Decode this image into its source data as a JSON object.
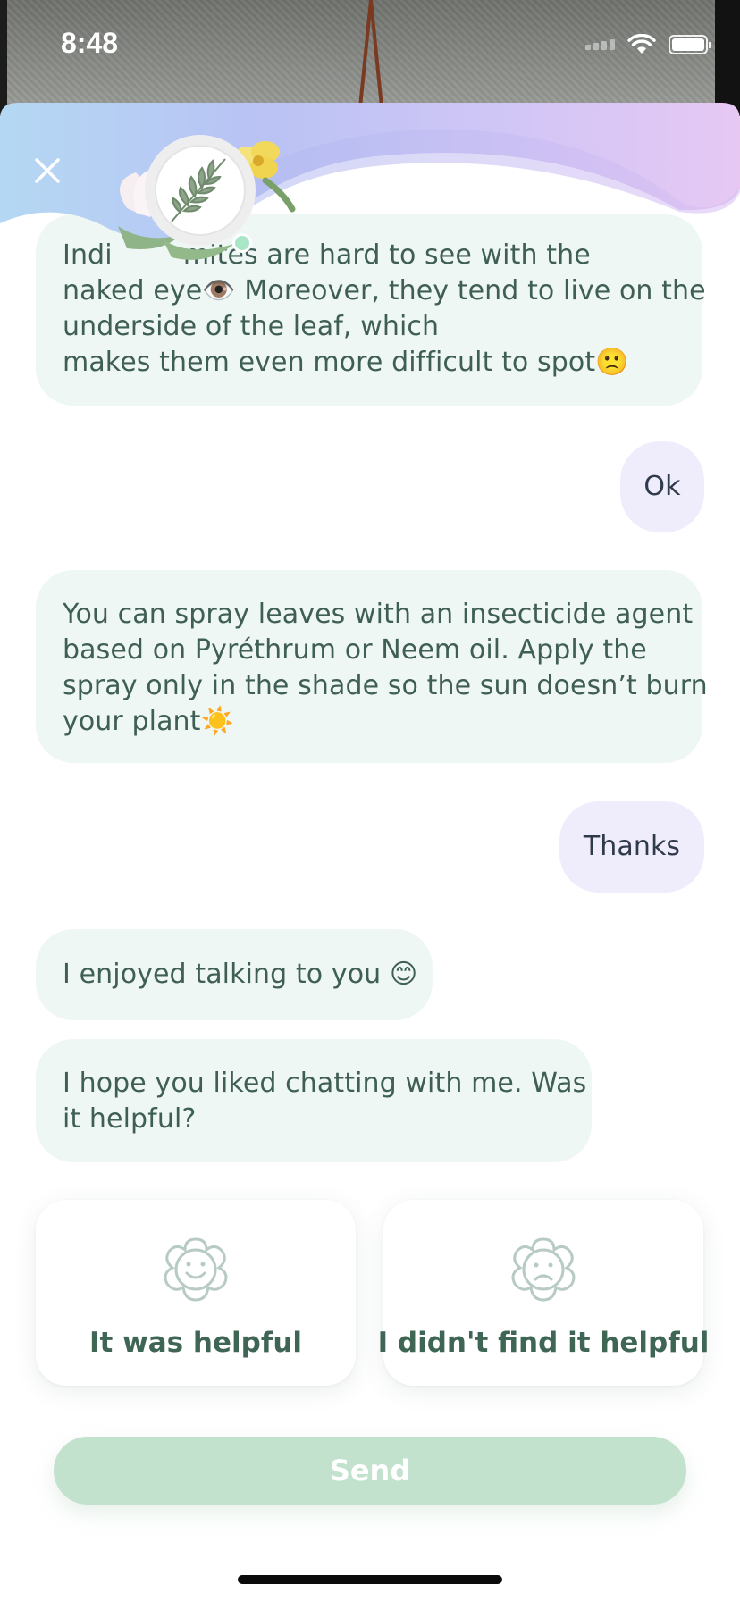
{
  "status_bar": {
    "time": "8:48"
  },
  "header": {
    "close_icon": "close-icon",
    "avatar_icon": "plant-avatar-icon"
  },
  "messages": [
    {
      "from": "bot",
      "lines": [
        "Indi             mites are hard to see with the",
        "naked eye👁️ Moreover, they tend to live on the",
        "underside of the leaf, which",
        "makes them even more difficult to spot🙁"
      ]
    },
    {
      "from": "user",
      "text": "Ok"
    },
    {
      "from": "bot",
      "lines": [
        "You can spray leaves with an insecticide agent",
        "based on Pyréthrum or Neem oil. Apply the",
        "spray only in the shade so the sun doesn’t burn",
        "your plant☀️"
      ]
    },
    {
      "from": "user",
      "text": "Thanks"
    },
    {
      "from": "bot",
      "lines": [
        "I enjoyed talking to you 😊"
      ]
    },
    {
      "from": "bot",
      "lines": [
        "I hope you liked chatting with me. Was",
        "it helpful?"
      ]
    }
  ],
  "feedback": {
    "helpful": {
      "label": "It was helpful",
      "icon": "happy-flower-icon"
    },
    "not_helpful": {
      "label": "I didn't find it helpful",
      "icon": "sad-flower-icon"
    }
  },
  "send_button": {
    "label": "Send"
  }
}
